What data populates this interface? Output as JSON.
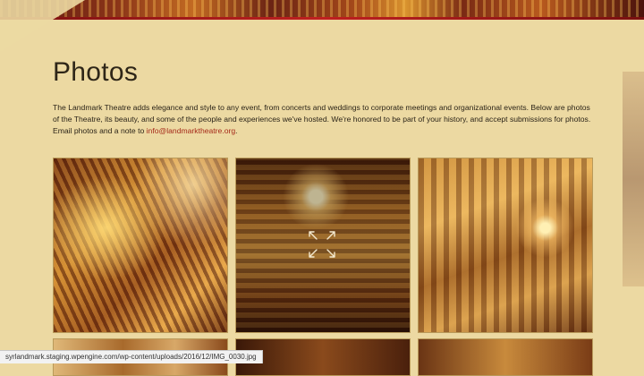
{
  "page": {
    "title": "Photos",
    "intro_text": "The Landmark Theatre adds elegance and style to any event, from concerts and weddings to corporate meetings and organizational events. Below are photos of the Theatre, its beauty, and some of the people and experiences we've hosted. We're honored to be part of your history, and accept submissions for photos. Email photos and a note to ",
    "intro_email": "info@landmarktheatre.org",
    "intro_end": "."
  },
  "gallery": {
    "photos": [
      {
        "icon": "ornate-ceiling-photo"
      },
      {
        "icon": "chandelier-balcony-photo",
        "hovered": true,
        "overlay_icon": "expand-icon"
      },
      {
        "icon": "staircase-lamp-photo"
      },
      {
        "icon": "gallery-photo"
      },
      {
        "icon": "gallery-photo"
      },
      {
        "icon": "gallery-photo"
      }
    ]
  },
  "status_bar": {
    "url": "syrlandmark.staging.wpengine.com/wp-content/uploads/2016/12/IMG_0030.jpg"
  },
  "colors": {
    "background": "#ecd9a2",
    "link": "#a52a1a",
    "text": "#2b2418"
  }
}
